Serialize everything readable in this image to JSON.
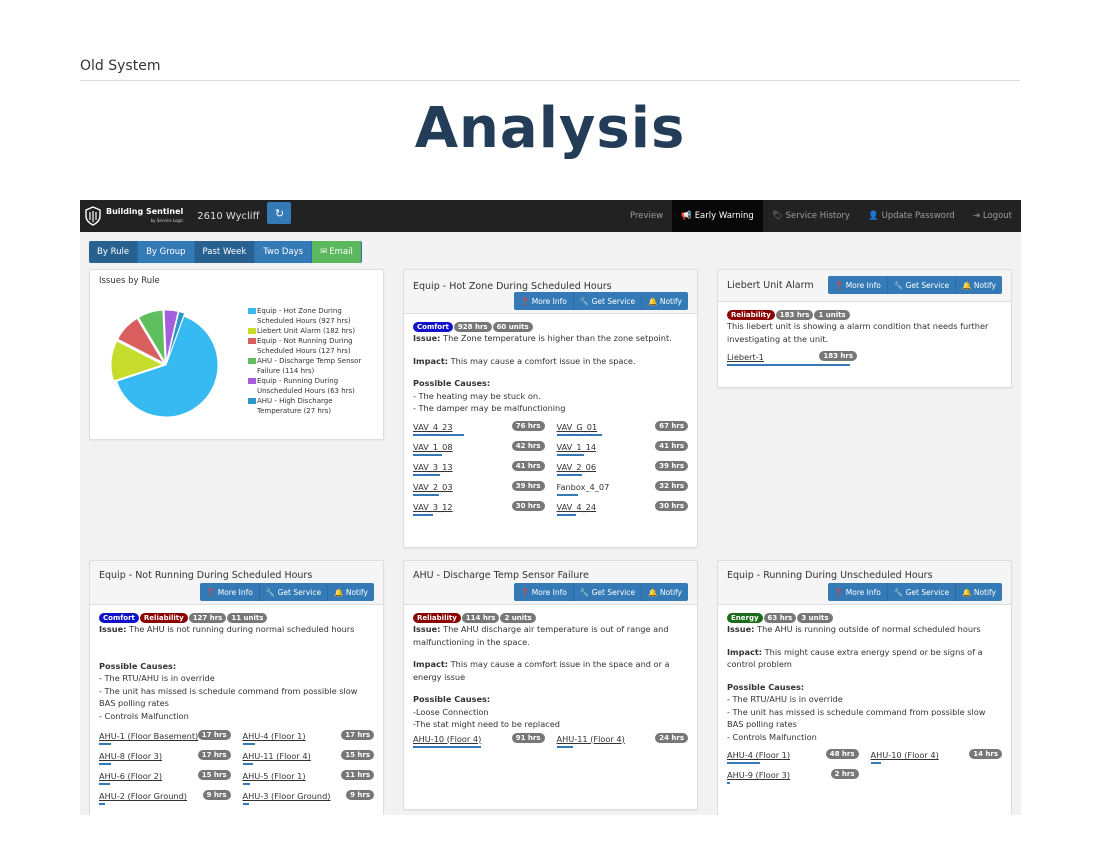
{
  "slide": {
    "label": "Old System",
    "title": "Analysis"
  },
  "navbar": {
    "brand": "Building Sentinel",
    "brand_sub": "by Service Logic",
    "site": "2610 Wycliff",
    "items": [
      {
        "label": "Preview",
        "icon": "",
        "active": false
      },
      {
        "label": "Early Warning",
        "icon": "bullhorn-icon",
        "active": true
      },
      {
        "label": "Service History",
        "icon": "tag-icon",
        "active": false
      },
      {
        "label": "Update Password",
        "icon": "user-icon",
        "active": false
      },
      {
        "label": "Logout",
        "icon": "logout-icon",
        "active": false
      }
    ]
  },
  "filters": [
    "By Rule",
    "By Group",
    "Past Week",
    "Two Days",
    "Email"
  ],
  "buttons": {
    "more_info": "More Info",
    "get_service": "Get Service",
    "notify": "Notify"
  },
  "labels": {
    "issue": "Issue:",
    "impact": "Impact:",
    "possible_causes": "Possible Causes:"
  },
  "chart_data": {
    "type": "pie",
    "title": "Issues by Rule",
    "slices": [
      {
        "label": "Equip - Hot Zone During Scheduled Hours (927 hrs)",
        "value": 927,
        "color": "#37b9f1"
      },
      {
        "label": "Liebert Unit Alarm (182 hrs)",
        "value": 182,
        "color": "#c6dc2d"
      },
      {
        "label": "Equip - Not Running During Scheduled Hours (127 hrs)",
        "value": 127,
        "color": "#d95f5f"
      },
      {
        "label": "AHU - Discharge Temp Sensor Failure (114 hrs)",
        "value": 114,
        "color": "#5fbf5f"
      },
      {
        "label": "Equip - Running During Unscheduled Hours (63 hrs)",
        "value": 63,
        "color": "#a55fdd"
      },
      {
        "label": "AHU - High Discharge Temperature (27 hrs)",
        "value": 27,
        "color": "#2f94c8"
      }
    ]
  },
  "hotzone": {
    "title": "Equip - Hot Zone During Scheduled Hours",
    "badges": [
      "Comfort",
      "928 hrs",
      "60 units"
    ],
    "issue": "The Zone temperature is higher than the zone setpoint.",
    "impact": "This may cause a comfort issue in the space.",
    "causes": [
      "- The heating may be stuck on.",
      "- The damper may be malfunctioning"
    ],
    "units": [
      {
        "name": "VAV_4_23",
        "hrs": "76 hrs",
        "frac": 0.34
      },
      {
        "name": "VAV_G_01",
        "hrs": "67 hrs",
        "frac": 0.3
      },
      {
        "name": "VAV_1_08",
        "hrs": "42 hrs",
        "frac": 0.19
      },
      {
        "name": "VAV_1_14",
        "hrs": "41 hrs",
        "frac": 0.18
      },
      {
        "name": "VAV_3_13",
        "hrs": "41 hrs",
        "frac": 0.18
      },
      {
        "name": "VAV_2_06",
        "hrs": "39 hrs",
        "frac": 0.17
      },
      {
        "name": "VAV_2_03",
        "hrs": "39 hrs",
        "frac": 0.17
      },
      {
        "name": "Fanbox_4_07",
        "hrs": "32 hrs",
        "frac": 0.14
      },
      {
        "name": "VAV_3_12",
        "hrs": "30 hrs",
        "frac": 0.13
      },
      {
        "name": "VAV_4_24",
        "hrs": "30 hrs",
        "frac": 0.13
      }
    ]
  },
  "liebert": {
    "title": "Liebert Unit Alarm",
    "badges": [
      "Reliability",
      "183 hrs",
      "1 units"
    ],
    "issue": "This liebert unit is showing a alarm condition that needs further investigating at the unit.",
    "units": [
      {
        "name": "Liebert-1",
        "hrs": "183 hrs",
        "frac": 0.82
      }
    ]
  },
  "notrunning": {
    "title": "Equip - Not Running During Scheduled Hours",
    "badges": [
      "Comfort",
      "Reliability",
      "127 hrs",
      "11 units"
    ],
    "issue": "The AHU is not running during normal scheduled hours",
    "causes": [
      "- The RTU/AHU is in override",
      "- The unit has missed is schedule command from possible slow BAS polling rates",
      "- Controls Malfunction"
    ],
    "units": [
      {
        "name": "AHU-1 (Floor Basement)",
        "hrs": "17 hrs",
        "frac": 0.08
      },
      {
        "name": "AHU-4 (Floor 1)",
        "hrs": "17 hrs",
        "frac": 0.08
      },
      {
        "name": "AHU-8 (Floor 3)",
        "hrs": "17 hrs",
        "frac": 0.08
      },
      {
        "name": "AHU-11 (Floor 4)",
        "hrs": "15 hrs",
        "frac": 0.07
      },
      {
        "name": "AHU-6 (Floor 2)",
        "hrs": "15 hrs",
        "frac": 0.07
      },
      {
        "name": "AHU-5 (Floor 1)",
        "hrs": "11 hrs",
        "frac": 0.05
      },
      {
        "name": "AHU-2 (Floor Ground)",
        "hrs": "9 hrs",
        "frac": 0.04
      },
      {
        "name": "AHU-3 (Floor Ground)",
        "hrs": "9 hrs",
        "frac": 0.04
      }
    ]
  },
  "discharge": {
    "title": "AHU - Discharge Temp Sensor Failure",
    "badges": [
      "Reliability",
      "114 hrs",
      "2 units"
    ],
    "issue": "The AHU discharge air temperature is out of range and malfunctioning in the space.",
    "impact": "This may cause a comfort issue in the space and or a energy issue",
    "causes": [
      "-Loose Connection",
      "-The stat might need to be replaced"
    ],
    "units": [
      {
        "name": "AHU-10 (Floor 4)",
        "hrs": "91 hrs",
        "frac": 0.45
      },
      {
        "name": "AHU-11 (Floor 4)",
        "hrs": "24 hrs",
        "frac": 0.11
      }
    ]
  },
  "unscheduled": {
    "title": "Equip - Running During Unscheduled Hours",
    "badges": [
      "Energy",
      "63 hrs",
      "3 units"
    ],
    "issue": "The AHU is running outside of normal scheduled hours",
    "impact": "This might cause extra energy spend or be signs of a control problem",
    "causes": [
      "- The RTU/AHU is in override",
      "- The unit has missed is schedule command from possible slow BAS polling rates",
      "- Controls Malfunction"
    ],
    "units": [
      {
        "name": "AHU-4 (Floor 1)",
        "hrs": "48 hrs",
        "frac": 0.22
      },
      {
        "name": "AHU-10 (Floor 4)",
        "hrs": "14 hrs",
        "frac": 0.07
      },
      {
        "name": "AHU-9 (Floor 3)",
        "hrs": "2 hrs",
        "frac": 0.01
      }
    ]
  }
}
